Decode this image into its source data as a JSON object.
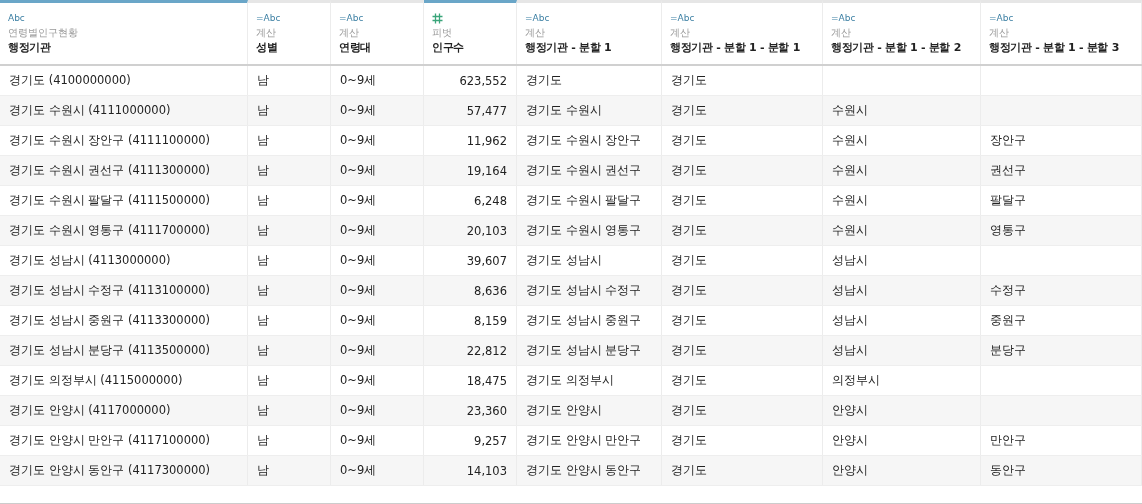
{
  "columns": [
    {
      "kind": "string",
      "type_label": "Abc",
      "source": "연령별인구현황",
      "name": "행정기관",
      "highlighted": true
    },
    {
      "kind": "calculated",
      "type_label": "=Abc",
      "source": "계산",
      "name": "성별",
      "highlighted": false
    },
    {
      "kind": "calculated",
      "type_label": "=Abc",
      "source": "계산",
      "name": "연령대",
      "highlighted": false
    },
    {
      "kind": "number",
      "source": "피벗",
      "name": "인구수",
      "highlighted": true
    },
    {
      "kind": "calculated",
      "type_label": "=Abc",
      "source": "계산",
      "name": "행정기관 - 분할 1",
      "highlighted": false
    },
    {
      "kind": "calculated",
      "type_label": "=Abc",
      "source": "계산",
      "name": "행정기관 - 분할 1 - 분할 1",
      "highlighted": false
    },
    {
      "kind": "calculated",
      "type_label": "=Abc",
      "source": "계산",
      "name": "행정기관 - 분할 1 - 분할 2",
      "highlighted": false
    },
    {
      "kind": "calculated",
      "type_label": "=Abc",
      "source": "계산",
      "name": "행정기관 - 분할 1 - 분할 3",
      "highlighted": false
    }
  ],
  "rows": [
    [
      "경기도  (4100000000)",
      "남",
      "0~9세",
      "623,552",
      "경기도",
      "경기도",
      "",
      ""
    ],
    [
      "경기도 수원시 (4111000000)",
      "남",
      "0~9세",
      "57,477",
      "경기도 수원시",
      "경기도",
      "수원시",
      ""
    ],
    [
      "경기도 수원시 장안구 (4111100000)",
      "남",
      "0~9세",
      "11,962",
      "경기도 수원시 장안구",
      "경기도",
      "수원시",
      "장안구"
    ],
    [
      "경기도 수원시 권선구 (4111300000)",
      "남",
      "0~9세",
      "19,164",
      "경기도 수원시 권선구",
      "경기도",
      "수원시",
      "권선구"
    ],
    [
      "경기도 수원시 팔달구 (4111500000)",
      "남",
      "0~9세",
      "6,248",
      "경기도 수원시 팔달구",
      "경기도",
      "수원시",
      "팔달구"
    ],
    [
      "경기도 수원시 영통구 (4111700000)",
      "남",
      "0~9세",
      "20,103",
      "경기도 수원시 영통구",
      "경기도",
      "수원시",
      "영통구"
    ],
    [
      "경기도 성남시 (4113000000)",
      "남",
      "0~9세",
      "39,607",
      "경기도 성남시",
      "경기도",
      "성남시",
      ""
    ],
    [
      "경기도 성남시 수정구 (4113100000)",
      "남",
      "0~9세",
      "8,636",
      "경기도 성남시 수정구",
      "경기도",
      "성남시",
      "수정구"
    ],
    [
      "경기도 성남시 중원구 (4113300000)",
      "남",
      "0~9세",
      "8,159",
      "경기도 성남시 중원구",
      "경기도",
      "성남시",
      "중원구"
    ],
    [
      "경기도 성남시 분당구 (4113500000)",
      "남",
      "0~9세",
      "22,812",
      "경기도 성남시 분당구",
      "경기도",
      "성남시",
      "분당구"
    ],
    [
      "경기도 의정부시 (4115000000)",
      "남",
      "0~9세",
      "18,475",
      "경기도 의정부시",
      "경기도",
      "의정부시",
      ""
    ],
    [
      "경기도 안양시 (4117000000)",
      "남",
      "0~9세",
      "23,360",
      "경기도 안양시",
      "경기도",
      "안양시",
      ""
    ],
    [
      "경기도 안양시 만안구 (4117100000)",
      "남",
      "0~9세",
      "9,257",
      "경기도 안양시 만안구",
      "경기도",
      "안양시",
      "만안구"
    ],
    [
      "경기도 안양시 동안구 (4117300000)",
      "남",
      "0~9세",
      "14,103",
      "경기도 안양시 동안구",
      "경기도",
      "안양시",
      "동안구"
    ]
  ]
}
